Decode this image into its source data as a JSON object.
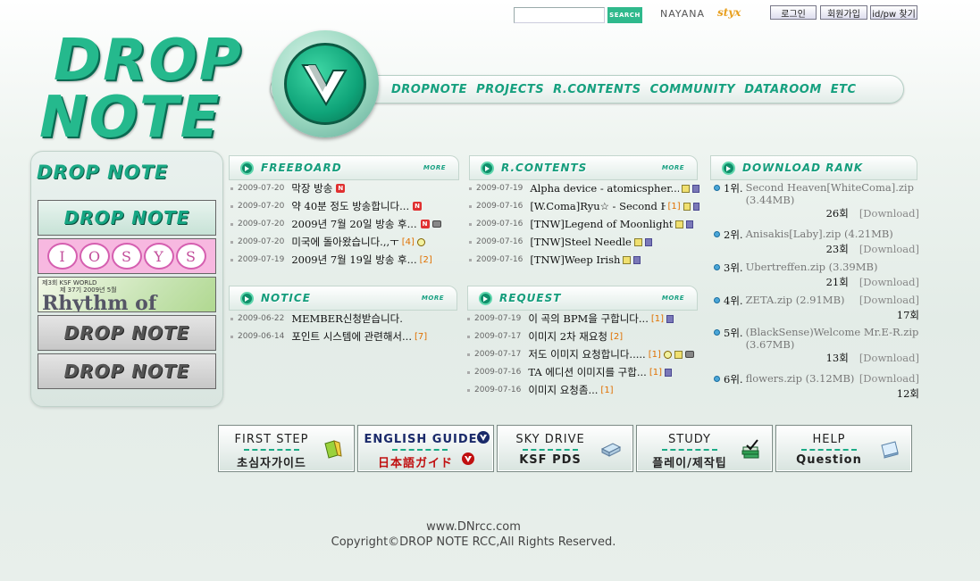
{
  "top": {
    "search_placeholder": "",
    "search_button": "SEARCH",
    "partner1": "NAYANA",
    "partner2": "styx",
    "login": "로그인",
    "join": "회원가입",
    "find_idpw": "id/pw 찾기"
  },
  "logo": {
    "word1": "DROP",
    "word2": "NOTE"
  },
  "nav": [
    "DROPNOTE",
    "PROJECTS",
    "R.CONTENTS",
    "COMMUNITY",
    "DATAROOM",
    "ETC"
  ],
  "sidebar": {
    "logo_text": "DROP NOTE",
    "banners": {
      "dropnote1": "DROP NOTE",
      "iosys": [
        "I",
        "O",
        "S",
        "Y",
        "S"
      ],
      "rhythm_top": "제3회 KSF WORLD",
      "rhythm_sub": "제 37기 2009년 5월",
      "rhythm_main": "Rhythm of Project",
      "dropnote2": "DROP NOTE",
      "dropnote3": "DROP NOTE"
    }
  },
  "more_label": "MORE",
  "freeboard": {
    "title": "FREEBOARD",
    "posts": [
      {
        "date": "2009-07-20",
        "title": "막장 방송",
        "count": ""
      },
      {
        "date": "2009-07-20",
        "title": "약 40분 정도 방송합니다...",
        "count": ""
      },
      {
        "date": "2009-07-20",
        "title": "2009년 7월 20일 방송 후...",
        "count": ""
      },
      {
        "date": "2009-07-20",
        "title": "미국에 돌아왔습니다.,,ㅜ",
        "count": "[4]"
      },
      {
        "date": "2009-07-19",
        "title": "2009년 7월 19일 방송 후...",
        "count": "[2]"
      }
    ]
  },
  "rcontents": {
    "title": "R.CONTENTS",
    "posts": [
      {
        "date": "2009-07-19",
        "title": "Alpha device - atomicspher...",
        "count": ""
      },
      {
        "date": "2009-07-16",
        "title": "[W.Coma]Ryu☆ - Second He...",
        "count": "[1]"
      },
      {
        "date": "2009-07-16",
        "title": "[TNW]Legend of Moonlight",
        "count": ""
      },
      {
        "date": "2009-07-16",
        "title": "[TNW]Steel Needle",
        "count": ""
      },
      {
        "date": "2009-07-16",
        "title": "[TNW]Weep Irish",
        "count": ""
      }
    ]
  },
  "notice": {
    "title": "NOTICE",
    "posts": [
      {
        "date": "2009-06-22",
        "title": "MEMBER신청받습니다.",
        "count": ""
      },
      {
        "date": "2009-06-14",
        "title": "포인트 시스템에 관련해서...",
        "count": "[7]"
      }
    ]
  },
  "request": {
    "title": "REQUEST",
    "posts": [
      {
        "date": "2009-07-19",
        "title": "이 곡의 BPM을 구합니다...",
        "count": "[1]"
      },
      {
        "date": "2009-07-17",
        "title": "이미지 2차 재요청",
        "count": "[2]"
      },
      {
        "date": "2009-07-17",
        "title": "저도 이미지 요청합니다.....",
        "count": "[1]"
      },
      {
        "date": "2009-07-16",
        "title": "TA 에디션 이미지를 구합...",
        "count": "[1]"
      },
      {
        "date": "2009-07-16",
        "title": "이미지 요청좀...",
        "count": "[1]"
      }
    ]
  },
  "download_rank": {
    "title": "DOWNLOAD RANK",
    "download_label": "[Download]",
    "items": [
      {
        "rank": "1위.",
        "name": "Second Heaven[WhiteComa].zip (3.44MB)",
        "count": "26회"
      },
      {
        "rank": "2위.",
        "name": "Anisakis[Laby].zip (4.21MB)",
        "count": "23회"
      },
      {
        "rank": "3위.",
        "name": "Ubertreffen.zip (3.39MB)",
        "count": "21회"
      },
      {
        "rank": "4위.",
        "name": "ZETA.zip (2.91MB)",
        "count": "17회"
      },
      {
        "rank": "5위.",
        "name": "(BlackSense)Welcome Mr.E-R.zip (3.67MB)",
        "count": "13회"
      },
      {
        "rank": "6위.",
        "name": "flowers.zip (3.12MB)",
        "count": "12회"
      }
    ]
  },
  "quick_buttons": [
    {
      "line1": "FIRST STEP",
      "line2": "초심자가이드",
      "icon": "note-icon"
    },
    {
      "line1": "ENGLISH GUIDE",
      "line2": "日本語ガイド",
      "icon": "dropnote-icon"
    },
    {
      "line1": "SKY DRIVE",
      "line2": "KSF PDS",
      "icon": "drive-icon"
    },
    {
      "line1": "STUDY",
      "line2": "플레이/제작팁",
      "icon": "books-icon"
    },
    {
      "line1": "HELP",
      "line2": "Question",
      "icon": "help-book-icon"
    }
  ],
  "footer": {
    "url": "www.DNrcc.com",
    "copyright": "Copyright©DROP NOTE RCC,All Rights Reserved."
  },
  "colors": {
    "accent": "#25b98d",
    "accent_dark": "#0a6a52",
    "count": "#e07000",
    "new_badge": "#e03030"
  }
}
